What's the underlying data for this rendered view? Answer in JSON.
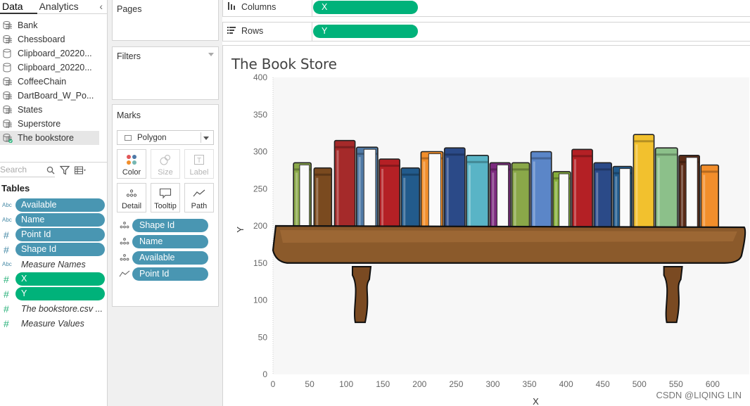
{
  "data_pane": {
    "tabs": [
      "Data",
      "Analytics"
    ],
    "datasources": [
      {
        "label": "Bank",
        "icon": "datasource-icon",
        "selected": false
      },
      {
        "label": "Chessboard",
        "icon": "datasource-icon",
        "selected": false
      },
      {
        "label": "Clipboard_20220...",
        "icon": "cylinder-icon",
        "selected": false
      },
      {
        "label": "Clipboard_20220...",
        "icon": "cylinder-icon",
        "selected": false
      },
      {
        "label": "CoffeeChain",
        "icon": "datasource-icon",
        "selected": false
      },
      {
        "label": "DartBoard_W_Po...",
        "icon": "datasource-icon",
        "selected": false
      },
      {
        "label": "States",
        "icon": "datasource-icon",
        "selected": false
      },
      {
        "label": "Superstore",
        "icon": "datasource-icon",
        "selected": false
      },
      {
        "label": "The bookstore",
        "icon": "datasource-active-icon",
        "selected": true
      }
    ],
    "search_placeholder": "Search",
    "tables_header": "Tables",
    "fields": [
      {
        "type": "Abc",
        "label": "Available",
        "style": "pill-blue"
      },
      {
        "type": "Abc",
        "label": "Name",
        "style": "pill-blue"
      },
      {
        "type": "#",
        "label": "Point Id",
        "style": "pill-blue"
      },
      {
        "type": "#",
        "label": "Shape Id",
        "style": "pill-blue"
      },
      {
        "type": "Abc",
        "label": "Measure Names",
        "style": "italic"
      },
      {
        "type": "#",
        "label": "X",
        "style": "pill-green"
      },
      {
        "type": "#",
        "label": "Y",
        "style": "pill-green"
      },
      {
        "type": "#",
        "label": "The bookstore.csv ...",
        "style": "italic"
      },
      {
        "type": "#",
        "label": "Measure Values",
        "style": "italic"
      }
    ]
  },
  "cards": {
    "pages_title": "Pages",
    "filters_title": "Filters",
    "marks_title": "Marks",
    "mark_type": "Polygon",
    "mark_buttons": [
      {
        "label": "Color",
        "icon": "color-dots-icon",
        "enabled": true
      },
      {
        "label": "Size",
        "icon": "size-icon",
        "enabled": false
      },
      {
        "label": "Label",
        "icon": "label-icon",
        "enabled": false
      },
      {
        "label": "Detail",
        "icon": "detail-dots-icon",
        "enabled": true
      },
      {
        "label": "Tooltip",
        "icon": "tooltip-icon",
        "enabled": true
      },
      {
        "label": "Path",
        "icon": "path-icon",
        "enabled": true
      }
    ],
    "mark_pills": [
      {
        "label": "Shape Id",
        "icon": "detail-dots-icon"
      },
      {
        "label": "Name",
        "icon": "detail-dots-icon"
      },
      {
        "label": "Available",
        "icon": "detail-dots-icon"
      },
      {
        "label": "Point Id",
        "icon": "path-icon"
      }
    ]
  },
  "shelves": {
    "columns_label": "Columns",
    "columns_pill": "X",
    "rows_label": "Rows",
    "rows_pill": "Y"
  },
  "viz": {
    "title": "The Book Store",
    "watermark": "CSDN @LIQING LIN"
  },
  "chart_data": {
    "type": "scatter",
    "title": "The Book Store",
    "xlabel": "X",
    "ylabel": "Y",
    "xlim": [
      0,
      650
    ],
    "ylim": [
      0,
      400
    ],
    "x_ticks": [
      0,
      50,
      100,
      150,
      200,
      250,
      300,
      350,
      400,
      450,
      500,
      550,
      600
    ],
    "y_ticks": [
      0,
      50,
      100,
      150,
      200,
      250,
      300,
      350,
      400
    ],
    "grid": false,
    "background": "#f7f7f7",
    "shelf": {
      "color": "#8b5a2b",
      "x": [
        0,
        645
      ],
      "y": [
        150,
        200
      ]
    },
    "brackets": [
      {
        "x": 120,
        "y": [
          70,
          145
        ]
      },
      {
        "x": 545,
        "y": [
          70,
          145
        ]
      }
    ],
    "books": [
      {
        "x": [
          28,
          52
        ],
        "y": [
          170,
          285
        ],
        "color": "#8aa849"
      },
      {
        "x": [
          56,
          80
        ],
        "y": [
          170,
          278
        ],
        "color": "#7a4a1f"
      },
      {
        "x": [
          84,
          112
        ],
        "y": [
          170,
          315
        ],
        "color": "#a52a2a"
      },
      {
        "x": [
          114,
          143
        ],
        "y": [
          170,
          306
        ],
        "color": "#4f79a5"
      },
      {
        "x": [
          145,
          173
        ],
        "y": [
          170,
          290
        ],
        "color": "#b42025"
      },
      {
        "x": [
          175,
          200
        ],
        "y": [
          170,
          278
        ],
        "color": "#225b8c"
      },
      {
        "x": [
          202,
          232
        ],
        "y": [
          170,
          300
        ],
        "color": "#f28e2b"
      },
      {
        "x": [
          234,
          262
        ],
        "y": [
          170,
          305
        ],
        "color": "#2b4a88"
      },
      {
        "x": [
          264,
          294
        ],
        "y": [
          170,
          295
        ],
        "color": "#59b4c6"
      },
      {
        "x": [
          296,
          324
        ],
        "y": [
          170,
          285
        ],
        "color": "#7b2a7e"
      },
      {
        "x": [
          326,
          350
        ],
        "y": [
          170,
          285
        ],
        "color": "#8aa849"
      },
      {
        "x": [
          352,
          380
        ],
        "y": [
          170,
          300
        ],
        "color": "#5b86c8"
      },
      {
        "x": [
          382,
          406
        ],
        "y": [
          170,
          273
        ],
        "color": "#85ad3b"
      },
      {
        "x": [
          408,
          436
        ],
        "y": [
          170,
          303
        ],
        "color": "#b42025"
      },
      {
        "x": [
          438,
          462
        ],
        "y": [
          170,
          285
        ],
        "color": "#2b4a88"
      },
      {
        "x": [
          464,
          490
        ],
        "y": [
          170,
          280
        ],
        "color": "#225b8c"
      },
      {
        "x": [
          492,
          520
        ],
        "y": [
          170,
          323
        ],
        "color": "#f2c12e"
      },
      {
        "x": [
          522,
          552
        ],
        "y": [
          170,
          305
        ],
        "color": "#8cc08a"
      },
      {
        "x": [
          554,
          582
        ],
        "y": [
          170,
          295
        ],
        "color": "#5a2a16"
      },
      {
        "x": [
          584,
          608
        ],
        "y": [
          170,
          282
        ],
        "color": "#f28e2b"
      }
    ]
  }
}
